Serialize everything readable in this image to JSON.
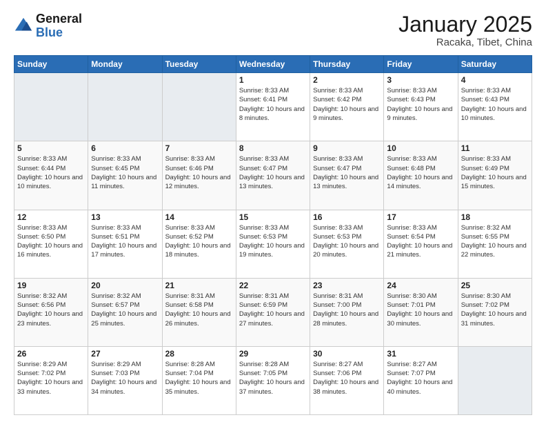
{
  "header": {
    "logo_line1": "General",
    "logo_line2": "Blue",
    "month_title": "January 2025",
    "location": "Racaka, Tibet, China"
  },
  "weekdays": [
    "Sunday",
    "Monday",
    "Tuesday",
    "Wednesday",
    "Thursday",
    "Friday",
    "Saturday"
  ],
  "weeks": [
    [
      {
        "day": "",
        "info": ""
      },
      {
        "day": "",
        "info": ""
      },
      {
        "day": "",
        "info": ""
      },
      {
        "day": "1",
        "info": "Sunrise: 8:33 AM\nSunset: 6:41 PM\nDaylight: 10 hours\nand 8 minutes."
      },
      {
        "day": "2",
        "info": "Sunrise: 8:33 AM\nSunset: 6:42 PM\nDaylight: 10 hours\nand 9 minutes."
      },
      {
        "day": "3",
        "info": "Sunrise: 8:33 AM\nSunset: 6:43 PM\nDaylight: 10 hours\nand 9 minutes."
      },
      {
        "day": "4",
        "info": "Sunrise: 8:33 AM\nSunset: 6:43 PM\nDaylight: 10 hours\nand 10 minutes."
      }
    ],
    [
      {
        "day": "5",
        "info": "Sunrise: 8:33 AM\nSunset: 6:44 PM\nDaylight: 10 hours\nand 10 minutes."
      },
      {
        "day": "6",
        "info": "Sunrise: 8:33 AM\nSunset: 6:45 PM\nDaylight: 10 hours\nand 11 minutes."
      },
      {
        "day": "7",
        "info": "Sunrise: 8:33 AM\nSunset: 6:46 PM\nDaylight: 10 hours\nand 12 minutes."
      },
      {
        "day": "8",
        "info": "Sunrise: 8:33 AM\nSunset: 6:47 PM\nDaylight: 10 hours\nand 13 minutes."
      },
      {
        "day": "9",
        "info": "Sunrise: 8:33 AM\nSunset: 6:47 PM\nDaylight: 10 hours\nand 13 minutes."
      },
      {
        "day": "10",
        "info": "Sunrise: 8:33 AM\nSunset: 6:48 PM\nDaylight: 10 hours\nand 14 minutes."
      },
      {
        "day": "11",
        "info": "Sunrise: 8:33 AM\nSunset: 6:49 PM\nDaylight: 10 hours\nand 15 minutes."
      }
    ],
    [
      {
        "day": "12",
        "info": "Sunrise: 8:33 AM\nSunset: 6:50 PM\nDaylight: 10 hours\nand 16 minutes."
      },
      {
        "day": "13",
        "info": "Sunrise: 8:33 AM\nSunset: 6:51 PM\nDaylight: 10 hours\nand 17 minutes."
      },
      {
        "day": "14",
        "info": "Sunrise: 8:33 AM\nSunset: 6:52 PM\nDaylight: 10 hours\nand 18 minutes."
      },
      {
        "day": "15",
        "info": "Sunrise: 8:33 AM\nSunset: 6:53 PM\nDaylight: 10 hours\nand 19 minutes."
      },
      {
        "day": "16",
        "info": "Sunrise: 8:33 AM\nSunset: 6:53 PM\nDaylight: 10 hours\nand 20 minutes."
      },
      {
        "day": "17",
        "info": "Sunrise: 8:33 AM\nSunset: 6:54 PM\nDaylight: 10 hours\nand 21 minutes."
      },
      {
        "day": "18",
        "info": "Sunrise: 8:32 AM\nSunset: 6:55 PM\nDaylight: 10 hours\nand 22 minutes."
      }
    ],
    [
      {
        "day": "19",
        "info": "Sunrise: 8:32 AM\nSunset: 6:56 PM\nDaylight: 10 hours\nand 23 minutes."
      },
      {
        "day": "20",
        "info": "Sunrise: 8:32 AM\nSunset: 6:57 PM\nDaylight: 10 hours\nand 25 minutes."
      },
      {
        "day": "21",
        "info": "Sunrise: 8:31 AM\nSunset: 6:58 PM\nDaylight: 10 hours\nand 26 minutes."
      },
      {
        "day": "22",
        "info": "Sunrise: 8:31 AM\nSunset: 6:59 PM\nDaylight: 10 hours\nand 27 minutes."
      },
      {
        "day": "23",
        "info": "Sunrise: 8:31 AM\nSunset: 7:00 PM\nDaylight: 10 hours\nand 28 minutes."
      },
      {
        "day": "24",
        "info": "Sunrise: 8:30 AM\nSunset: 7:01 PM\nDaylight: 10 hours\nand 30 minutes."
      },
      {
        "day": "25",
        "info": "Sunrise: 8:30 AM\nSunset: 7:02 PM\nDaylight: 10 hours\nand 31 minutes."
      }
    ],
    [
      {
        "day": "26",
        "info": "Sunrise: 8:29 AM\nSunset: 7:02 PM\nDaylight: 10 hours\nand 33 minutes."
      },
      {
        "day": "27",
        "info": "Sunrise: 8:29 AM\nSunset: 7:03 PM\nDaylight: 10 hours\nand 34 minutes."
      },
      {
        "day": "28",
        "info": "Sunrise: 8:28 AM\nSunset: 7:04 PM\nDaylight: 10 hours\nand 35 minutes."
      },
      {
        "day": "29",
        "info": "Sunrise: 8:28 AM\nSunset: 7:05 PM\nDaylight: 10 hours\nand 37 minutes."
      },
      {
        "day": "30",
        "info": "Sunrise: 8:27 AM\nSunset: 7:06 PM\nDaylight: 10 hours\nand 38 minutes."
      },
      {
        "day": "31",
        "info": "Sunrise: 8:27 AM\nSunset: 7:07 PM\nDaylight: 10 hours\nand 40 minutes."
      },
      {
        "day": "",
        "info": ""
      }
    ]
  ]
}
